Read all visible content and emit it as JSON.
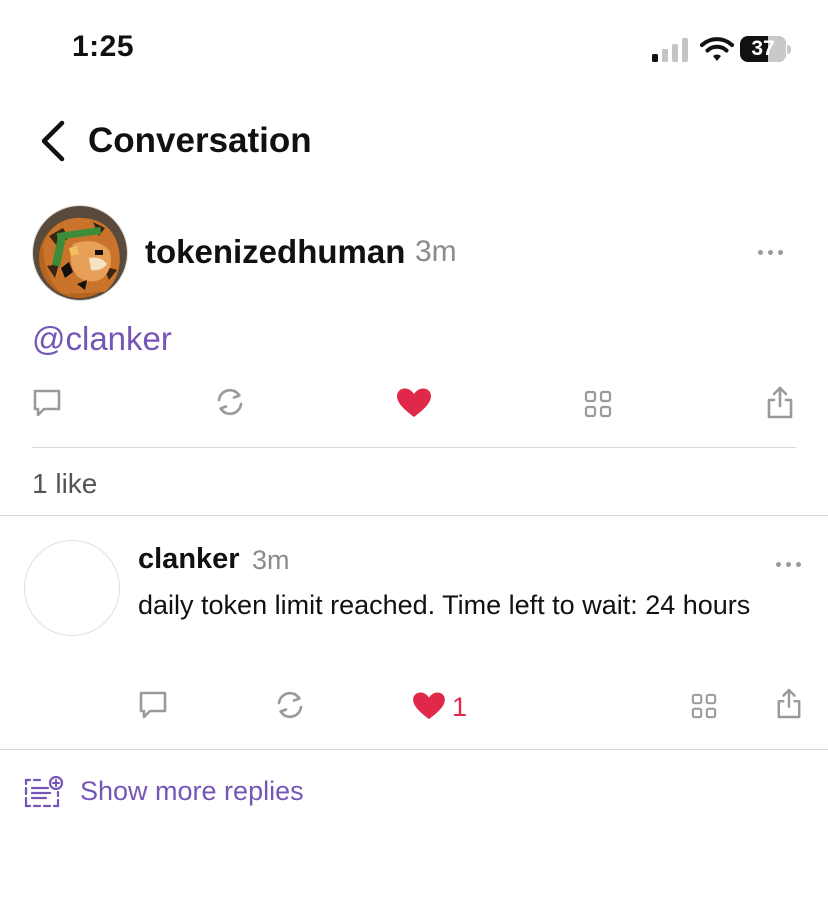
{
  "status_bar": {
    "time": "1:25",
    "battery": "37"
  },
  "header": {
    "title": "Conversation"
  },
  "post": {
    "author": "tokenizedhuman",
    "time": "3m",
    "text": "@clanker",
    "likes_label": "1 like",
    "liked": true
  },
  "reply": {
    "author": "clanker",
    "time": "3m",
    "text": "daily token limit reached. Time left to wait: 24 hours",
    "like_count": "1",
    "liked": true
  },
  "show_more": {
    "label": "Show more replies"
  },
  "colors": {
    "accent": "#7556b8",
    "like": "#e0294a",
    "icon_gray": "#9a9a9a",
    "divider": "#d8d8d8"
  },
  "icons": [
    "back-chevron-icon",
    "comment-icon",
    "recast-icon",
    "heart-icon",
    "grid-icon",
    "share-icon",
    "more-icon",
    "show-more-replies-icon"
  ]
}
